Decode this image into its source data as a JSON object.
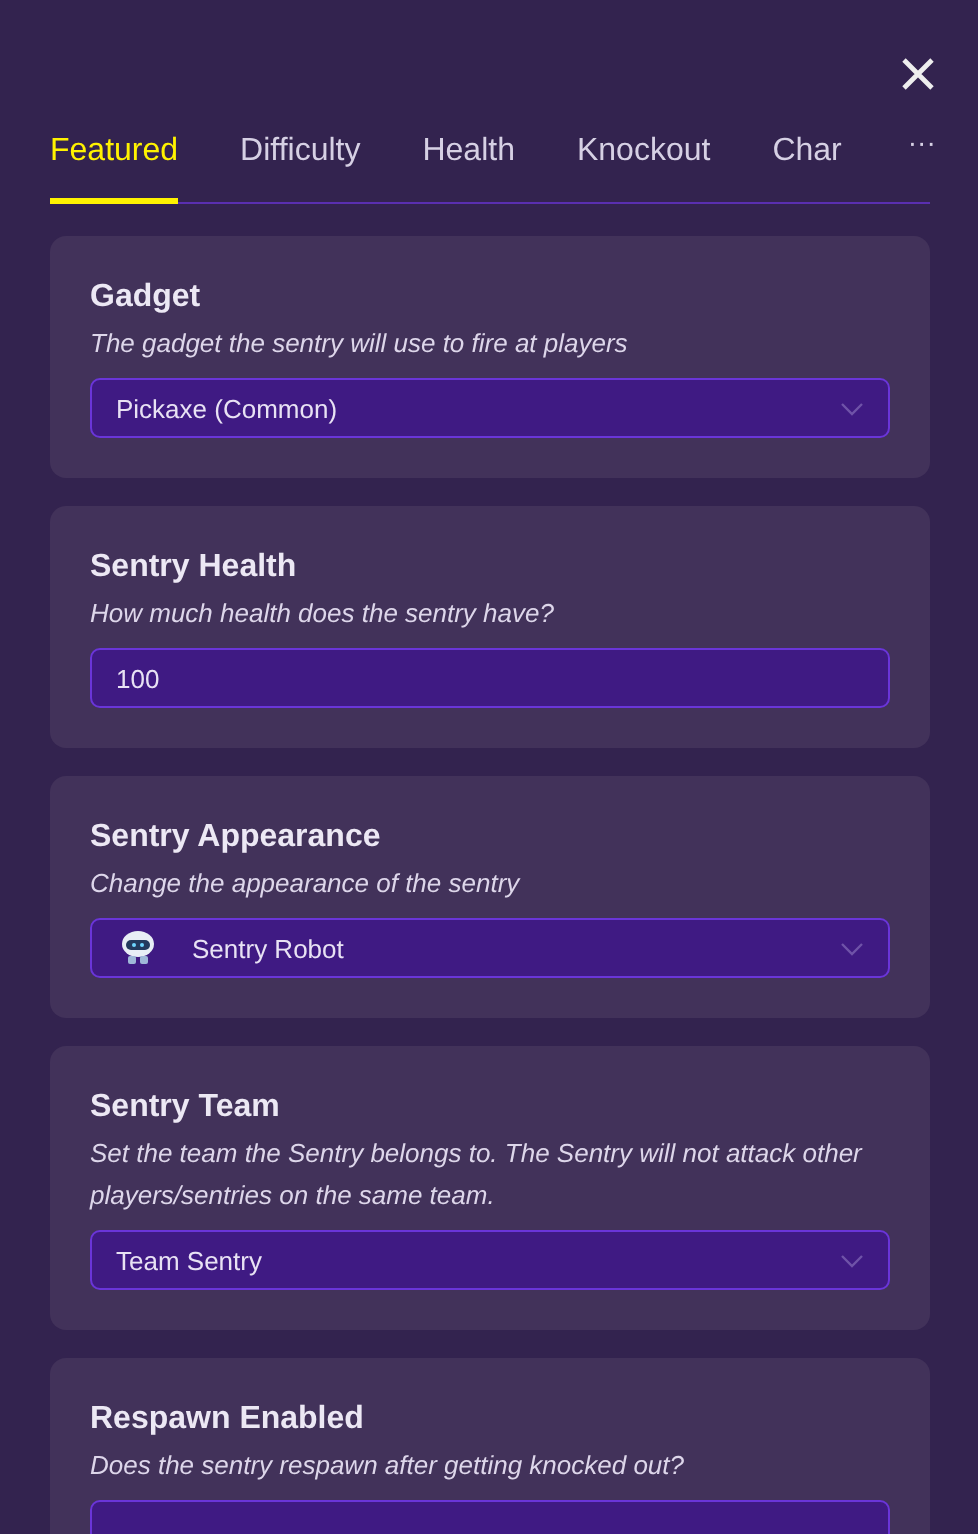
{
  "tabs": [
    {
      "label": "Featured",
      "selected": true
    },
    {
      "label": "Difficulty",
      "selected": false
    },
    {
      "label": "Health",
      "selected": false
    },
    {
      "label": "Knockout",
      "selected": false
    },
    {
      "label": "Char",
      "selected": false
    }
  ],
  "more_tabs": "···",
  "sections": [
    {
      "title": "Gadget",
      "description": "The gadget the sentry will use to fire at players",
      "field": {
        "kind": "dropdown",
        "value": "Pickaxe (Common)"
      }
    },
    {
      "title": "Sentry Health",
      "description": "How much health does the sentry have?",
      "field": {
        "kind": "input",
        "value": "100"
      }
    },
    {
      "title": "Sentry Appearance",
      "description": "Change the appearance of the sentry",
      "field": {
        "kind": "image_dropdown",
        "value": "Sentry Robot"
      }
    },
    {
      "title": "Sentry Team",
      "description": "Set the team the Sentry belongs to. The Sentry will not attack other players/sentries on the same team.",
      "field": {
        "kind": "dropdown",
        "value": "Team Sentry"
      }
    },
    {
      "title": "Respawn Enabled",
      "description": "Does the sentry respawn after getting knocked out?",
      "field": {
        "kind": "dropdown"
      }
    }
  ]
}
